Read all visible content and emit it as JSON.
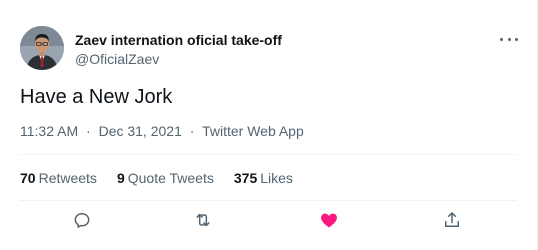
{
  "tweet": {
    "author": {
      "display_name": "Zaev internation oficial take-off",
      "handle": "@OficialZaev"
    },
    "text": "Have a New Jork",
    "meta": {
      "time": "11:32 AM",
      "separator": "·",
      "date": "Dec 31, 2021",
      "source": "Twitter Web App"
    },
    "stats": {
      "retweets_count": "70",
      "retweets_label": "Retweets",
      "quotes_count": "9",
      "quotes_label": "Quote Tweets",
      "likes_count": "375",
      "likes_label": "Likes"
    },
    "actions": [
      {
        "name": "reply-icon"
      },
      {
        "name": "retweet-icon"
      },
      {
        "name": "like-icon",
        "active": true
      },
      {
        "name": "share-icon"
      }
    ]
  },
  "colors": {
    "text_primary": "#0f1419",
    "text_secondary": "#536471",
    "divider": "#eff3f4",
    "like_active": "#f91880"
  }
}
